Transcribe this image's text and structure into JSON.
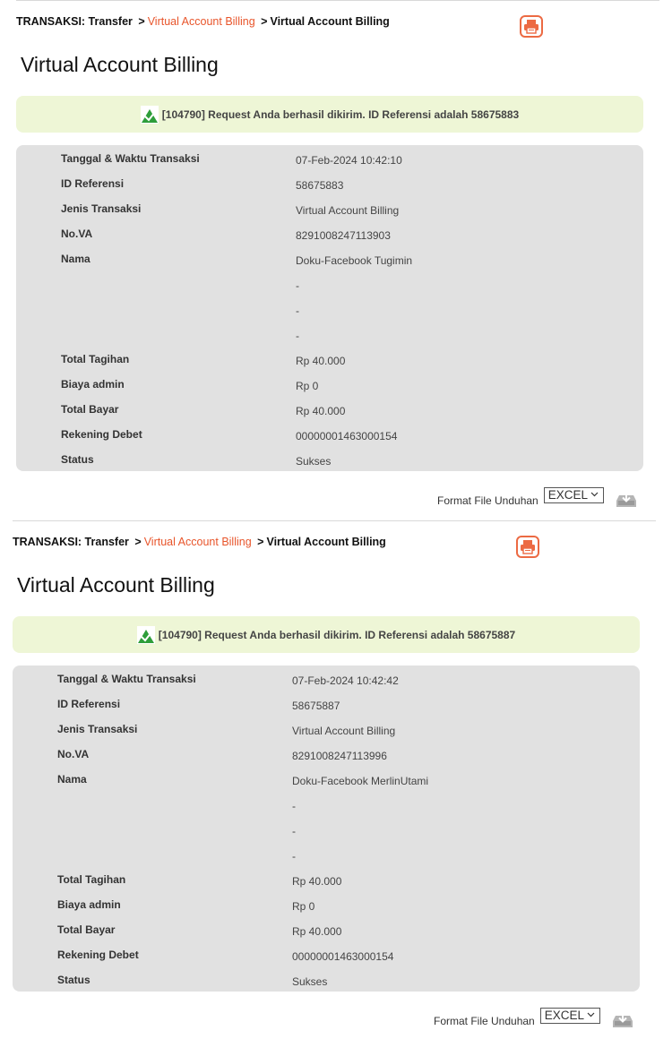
{
  "receipts": [
    {
      "breadcrumb": {
        "root": "TRANSAKSI: Transfer",
        "sep": ">",
        "link": "Virtual Account Billing",
        "current": "Virtual Account Billing"
      },
      "title": "Virtual Account Billing",
      "alert": "[104790] Request Anda berhasil dikirim. ID Referensi adalah 58675883",
      "rows": [
        {
          "label": "Tanggal & Waktu Transaksi",
          "value": "07-Feb-2024 10:42:10"
        },
        {
          "label": "ID Referensi",
          "value": "58675883"
        },
        {
          "label": "Jenis Transaksi",
          "value": "Virtual Account Billing"
        },
        {
          "label": "No.VA",
          "value": "8291008247113903"
        },
        {
          "label": "Nama",
          "value": "Doku-Facebook Tugimin"
        },
        {
          "label": "",
          "value": "-"
        },
        {
          "label": "",
          "value": "-"
        },
        {
          "label": "",
          "value": "-"
        },
        {
          "label": "Total Tagihan",
          "value": "Rp 40.000"
        },
        {
          "label": "Biaya admin",
          "value": "Rp 0"
        },
        {
          "label": "Total Bayar",
          "value": "Rp 40.000"
        },
        {
          "label": "Rekening Debet",
          "value": "00000001463000154"
        },
        {
          "label": "Status",
          "value": "Sukses"
        }
      ],
      "download_label": "Format File Unduhan",
      "format": "EXCEL"
    },
    {
      "breadcrumb": {
        "root": "TRANSAKSI: Transfer",
        "sep": ">",
        "link": "Virtual Account Billing",
        "current": "Virtual Account Billing"
      },
      "title": "Virtual Account Billing",
      "alert": "[104790] Request Anda berhasil dikirim. ID Referensi adalah 58675887",
      "rows": [
        {
          "label": "Tanggal & Waktu Transaksi",
          "value": "07-Feb-2024 10:42:42"
        },
        {
          "label": "ID Referensi",
          "value": "58675887"
        },
        {
          "label": "Jenis Transaksi",
          "value": "Virtual Account Billing"
        },
        {
          "label": "No.VA",
          "value": "8291008247113996"
        },
        {
          "label": "Nama",
          "value": "Doku-Facebook MerlinUtami"
        },
        {
          "label": "",
          "value": "-"
        },
        {
          "label": "",
          "value": "-"
        },
        {
          "label": "",
          "value": "-"
        },
        {
          "label": "Total Tagihan",
          "value": "Rp 40.000"
        },
        {
          "label": "Biaya admin",
          "value": "Rp 0"
        },
        {
          "label": "Total Bayar",
          "value": "Rp 40.000"
        },
        {
          "label": "Rekening Debet",
          "value": "00000001463000154"
        },
        {
          "label": "Status",
          "value": "Sukses"
        }
      ],
      "download_label": "Format File Unduhan",
      "format": "EXCEL"
    }
  ],
  "icons": {
    "print": "printer-icon",
    "success": "success-check-icon",
    "download": "download-tray-icon",
    "dropdown": "chevron-down-icon"
  },
  "colors": {
    "accent": "#e8552b",
    "alert_bg": "#eef6d6",
    "panel_bg": "#e1e1e1"
  }
}
